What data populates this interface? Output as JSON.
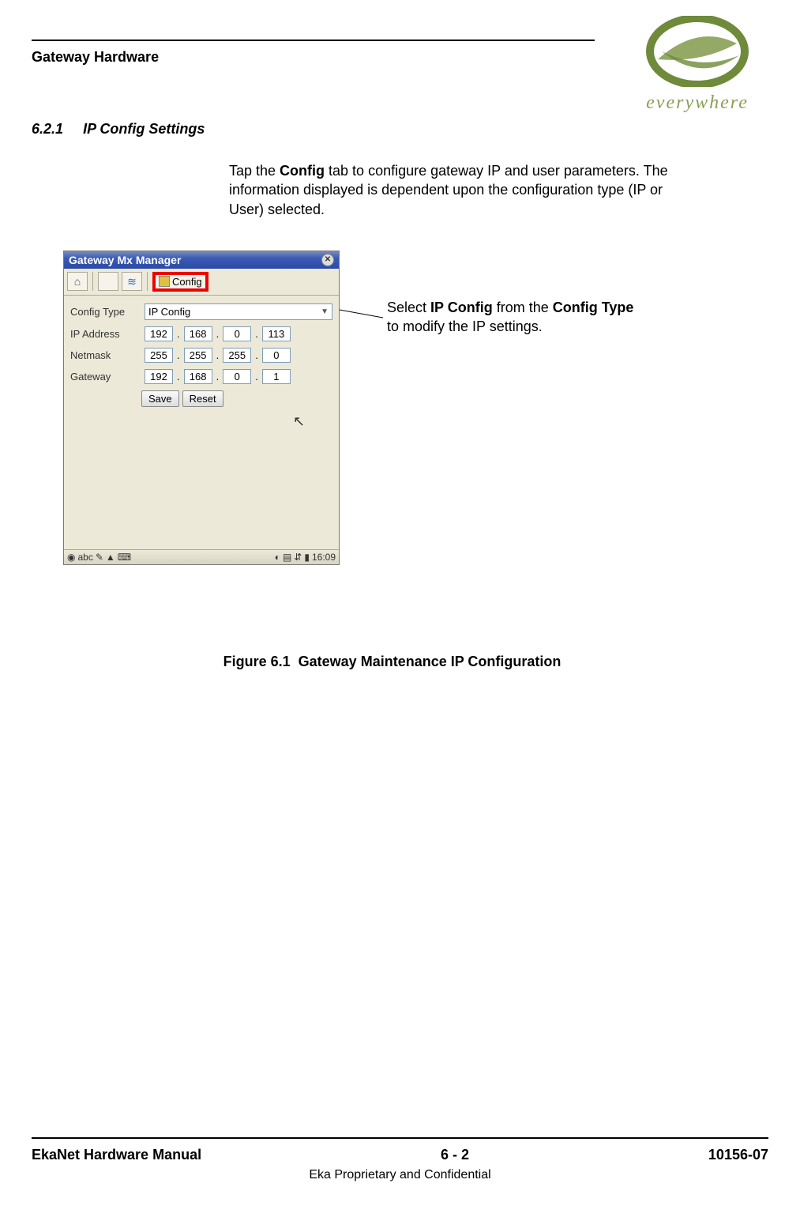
{
  "header": {
    "title": "Gateway Hardware"
  },
  "logo": {
    "text": "everywhere"
  },
  "section": {
    "number": "6.2.1",
    "title": "IP Config Settings"
  },
  "body": {
    "p1_a": "Tap the ",
    "p1_b": "Config",
    "p1_c": " tab to configure gateway IP and user parameters. The information displayed is dependent upon the configuration type (IP or User) selected."
  },
  "app": {
    "title": "Gateway Mx Manager",
    "config_tab_label": "Config",
    "labels": {
      "config_type": "Config Type",
      "ip": "IP Address",
      "netmask": "Netmask",
      "gateway": "Gateway"
    },
    "config_type_value": "IP Config",
    "ip": [
      "192",
      "168",
      "0",
      "113"
    ],
    "netmask": [
      "255",
      "255",
      "255",
      "0"
    ],
    "gateway_ip": [
      "192",
      "168",
      "0",
      "1"
    ],
    "buttons": {
      "save": "Save",
      "reset": "Reset"
    },
    "taskbar": {
      "clock": "16:09",
      "abc": "abc"
    }
  },
  "callout": {
    "a": "Select ",
    "b": "IP Config",
    "c": " from the ",
    "d": "Config Type",
    "e": " to modify the IP settings."
  },
  "figure": {
    "label": "Figure 6.1",
    "caption": "Gateway Maintenance IP Configuration"
  },
  "footer": {
    "left": "EkaNet Hardware Manual",
    "mid": "6 - 2",
    "right": "10156-07",
    "sub": "Eka Proprietary and Confidential"
  }
}
